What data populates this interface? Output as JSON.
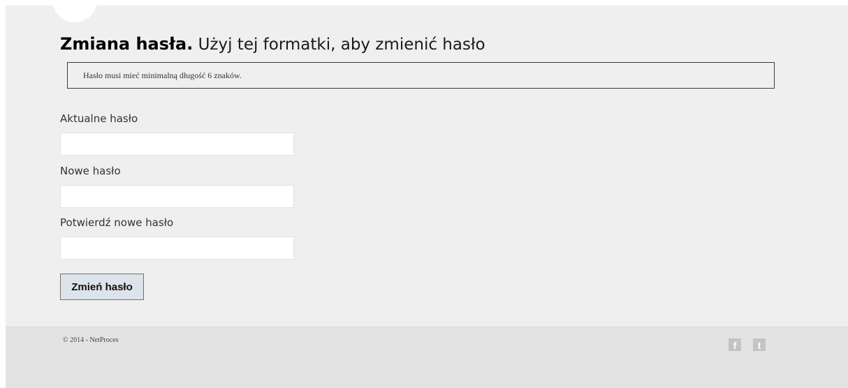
{
  "header": {
    "title_bold": "Zmiana hasła.",
    "title_rest": "Użyj tej formatki, aby zmienić hasło"
  },
  "notice": {
    "text": "Hasło musi mieć minimalną długość 6 znaków."
  },
  "form": {
    "current_password": {
      "label": "Aktualne hasło",
      "value": "",
      "placeholder": ""
    },
    "new_password": {
      "label": "Nowe hasło",
      "value": "",
      "placeholder": ""
    },
    "confirm_password": {
      "label": "Potwierdź nowe hasło",
      "value": "",
      "placeholder": ""
    },
    "submit_label": "Zmień hasło"
  },
  "footer": {
    "copyright": "© 2014 - NetProces",
    "social": [
      {
        "icon": "facebook-icon",
        "glyph": "f"
      },
      {
        "icon": "tumblr-icon",
        "glyph": "t"
      }
    ]
  }
}
